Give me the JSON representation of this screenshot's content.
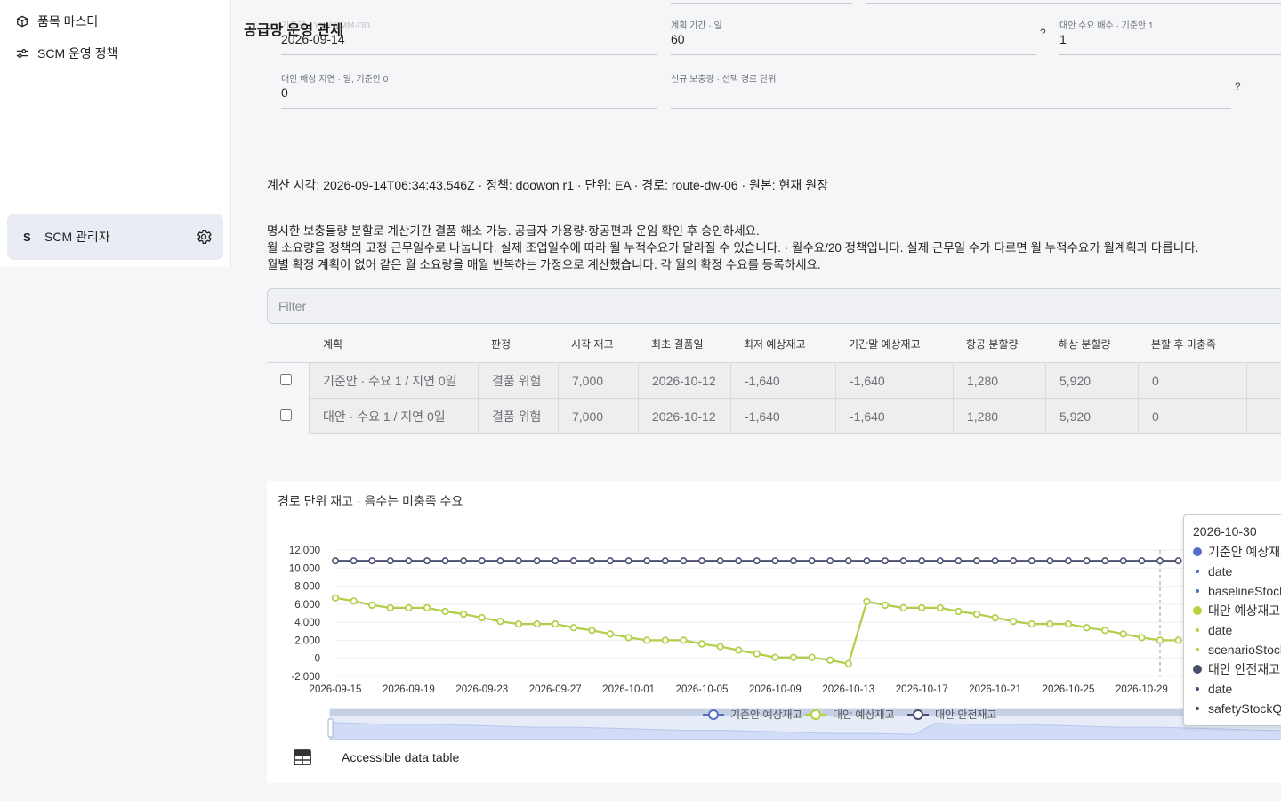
{
  "sidebar": {
    "items": [
      {
        "label": "품목 마스터",
        "icon": "cube-icon"
      },
      {
        "label": "SCM 운영 정책",
        "icon": "sliders-icon"
      }
    ],
    "user": {
      "initial": "S",
      "name": "SCM 관리자",
      "icon": "gear-icon"
    }
  },
  "page": {
    "title": "공급망 운영 관제"
  },
  "form": {
    "base_date": {
      "label": "기준일 · YYYY-MM-DD",
      "value": "2026-09-14"
    },
    "plan_period": {
      "label": "계획 기간 · 일",
      "value": "60"
    },
    "demand_multiplier": {
      "label": "대안 수요 배수 · 기준안 1",
      "value": "1"
    },
    "sea_delay": {
      "label": "대안 해상 지연 · 일, 기준안 0",
      "value": "0"
    },
    "new_replenishment": {
      "label": "신규 보충량 · 선택 경로 단위",
      "value": ""
    },
    "help_label": "?"
  },
  "info_line": "계산 시각: 2026-09-14T06:34:43.546Z · 정책: doowon r1 · 단위: EA · 경로: route-dw-06 · 원본: 현재 원장",
  "notes": [
    "명시한 보충물량 분할로 계산기간 결품 해소 가능. 공급자 가용량·항공편과 운임 확인 후 승인하세요.",
    "월 소요량을 정책의 고정 근무일수로 나눕니다. 실제 조업일수에 따라 월 누적수요가 달라질 수 있습니다. · 월수요/20 정책입니다. 실제 근무일 수가 다르면 월 누적수요가 월계획과 다릅니다.",
    "월별 확정 계획이 없어 같은 월 소요량을 매월 반복하는 가정으로 계산했습니다. 각 월의 확정 수요를 등록하세요."
  ],
  "filter": {
    "placeholder": "Filter"
  },
  "table": {
    "columns": [
      "계획",
      "판정",
      "시작 재고",
      "최초 결품일",
      "최저 예상재고",
      "기간말 예상재고",
      "항공 분할량",
      "해상 분할량",
      "분할 후 미충족"
    ],
    "rows": [
      [
        "기준안 · 수요 1 / 지연 0일",
        "결품 위험",
        "7,000",
        "2026-10-12",
        "-1,640",
        "-1,640",
        "1,280",
        "5,920",
        "0"
      ],
      [
        "대안 · 수요 1 / 지연 0일",
        "결품 위험",
        "7,000",
        "2026-10-12",
        "-1,640",
        "-1,640",
        "1,280",
        "5,920",
        "0"
      ]
    ]
  },
  "chart_data": {
    "type": "line",
    "title": "경로 단위 재고 · 음수는 미충족 수요",
    "xlabel": "",
    "ylabel": "",
    "x_ticks": [
      "2026-09-15",
      "2026-09-19",
      "2026-09-23",
      "2026-09-27",
      "2026-10-01",
      "2026-10-05",
      "2026-10-09",
      "2026-10-13",
      "2026-10-17",
      "2026-10-21",
      "2026-10-25",
      "2026-10-29"
    ],
    "y_ticks": [
      "12,000",
      "10,000",
      "8,000",
      "6,000",
      "4,000",
      "2,000",
      "0",
      "-2,000"
    ],
    "ylim": [
      -2000,
      12000
    ],
    "x": [
      "2026-09-15",
      "2026-09-16",
      "2026-09-17",
      "2026-09-18",
      "2026-09-19",
      "2026-09-20",
      "2026-09-21",
      "2026-09-22",
      "2026-09-23",
      "2026-09-24",
      "2026-09-25",
      "2026-09-26",
      "2026-09-27",
      "2026-09-28",
      "2026-09-29",
      "2026-09-30",
      "2026-10-01",
      "2026-10-02",
      "2026-10-03",
      "2026-10-04",
      "2026-10-05",
      "2026-10-06",
      "2026-10-07",
      "2026-10-08",
      "2026-10-09",
      "2026-10-10",
      "2026-10-11",
      "2026-10-12",
      "2026-10-13",
      "2026-10-14",
      "2026-10-15",
      "2026-10-16",
      "2026-10-17",
      "2026-10-18",
      "2026-10-19",
      "2026-10-20",
      "2026-10-21",
      "2026-10-22",
      "2026-10-23",
      "2026-10-24",
      "2026-10-25",
      "2026-10-26",
      "2026-10-27",
      "2026-10-28",
      "2026-10-29",
      "2026-10-30",
      "2026-10-31"
    ],
    "series": [
      {
        "name": "기준안 예상재고",
        "color": "#5470c6",
        "values": [
          6700,
          6350,
          5900,
          5600,
          5600,
          5600,
          5200,
          4900,
          4500,
          4100,
          3800,
          3800,
          3800,
          3400,
          3100,
          2700,
          2300,
          2000,
          2000,
          2000,
          1600,
          1300,
          900,
          500,
          100,
          100,
          100,
          -200,
          -600,
          6300,
          5900,
          5600,
          5600,
          5600,
          5200,
          4900,
          4500,
          4100,
          3800,
          3800,
          3800,
          3400,
          3100,
          2700,
          2300,
          2000,
          2000
        ]
      },
      {
        "name": "대안 예상재고",
        "color": "#b5d33d",
        "values": [
          6700,
          6350,
          5900,
          5600,
          5600,
          5600,
          5200,
          4900,
          4500,
          4100,
          3800,
          3800,
          3800,
          3400,
          3100,
          2700,
          2300,
          2000,
          2000,
          2000,
          1600,
          1300,
          900,
          500,
          100,
          100,
          100,
          -200,
          -600,
          6300,
          5900,
          5600,
          5600,
          5600,
          5200,
          4900,
          4500,
          4100,
          3800,
          3800,
          3800,
          3400,
          3100,
          2700,
          2300,
          2000,
          2000
        ]
      },
      {
        "name": "대안 안전재고",
        "color": "#4b4f6e",
        "values": [
          10800,
          10800,
          10800,
          10800,
          10800,
          10800,
          10800,
          10800,
          10800,
          10800,
          10800,
          10800,
          10800,
          10800,
          10800,
          10800,
          10800,
          10800,
          10800,
          10800,
          10800,
          10800,
          10800,
          10800,
          10800,
          10800,
          10800,
          10800,
          10800,
          10800,
          10800,
          10800,
          10800,
          10800,
          10800,
          10800,
          10800,
          10800,
          10800,
          10800,
          10800,
          10800,
          10800,
          10800,
          10800,
          10800,
          10800
        ]
      }
    ],
    "legend_position": "bottom",
    "tooltip": {
      "date": "2026-10-30",
      "rows": [
        {
          "kind": "series",
          "text": "기준안 예상재고",
          "color": "#5470c6"
        },
        {
          "kind": "field",
          "text": "date",
          "color": "#5470c6"
        },
        {
          "kind": "field",
          "text": "baselineStock",
          "color": "#5470c6"
        },
        {
          "kind": "series",
          "text": "대안 예상재고",
          "color": "#b5d33d"
        },
        {
          "kind": "field",
          "text": "date",
          "color": "#b5d33d"
        },
        {
          "kind": "field",
          "text": "scenarioStock",
          "color": "#b5d33d"
        },
        {
          "kind": "series",
          "text": "대안 안전재고",
          "color": "#4b4f6e"
        },
        {
          "kind": "field",
          "text": "date",
          "color": "#4b4f6e"
        },
        {
          "kind": "field",
          "text": "safetyStockQty",
          "color": "#4b4f6e"
        }
      ]
    }
  },
  "data_table_toggle": {
    "label": "Accessible data table",
    "icon": "table-icon"
  }
}
